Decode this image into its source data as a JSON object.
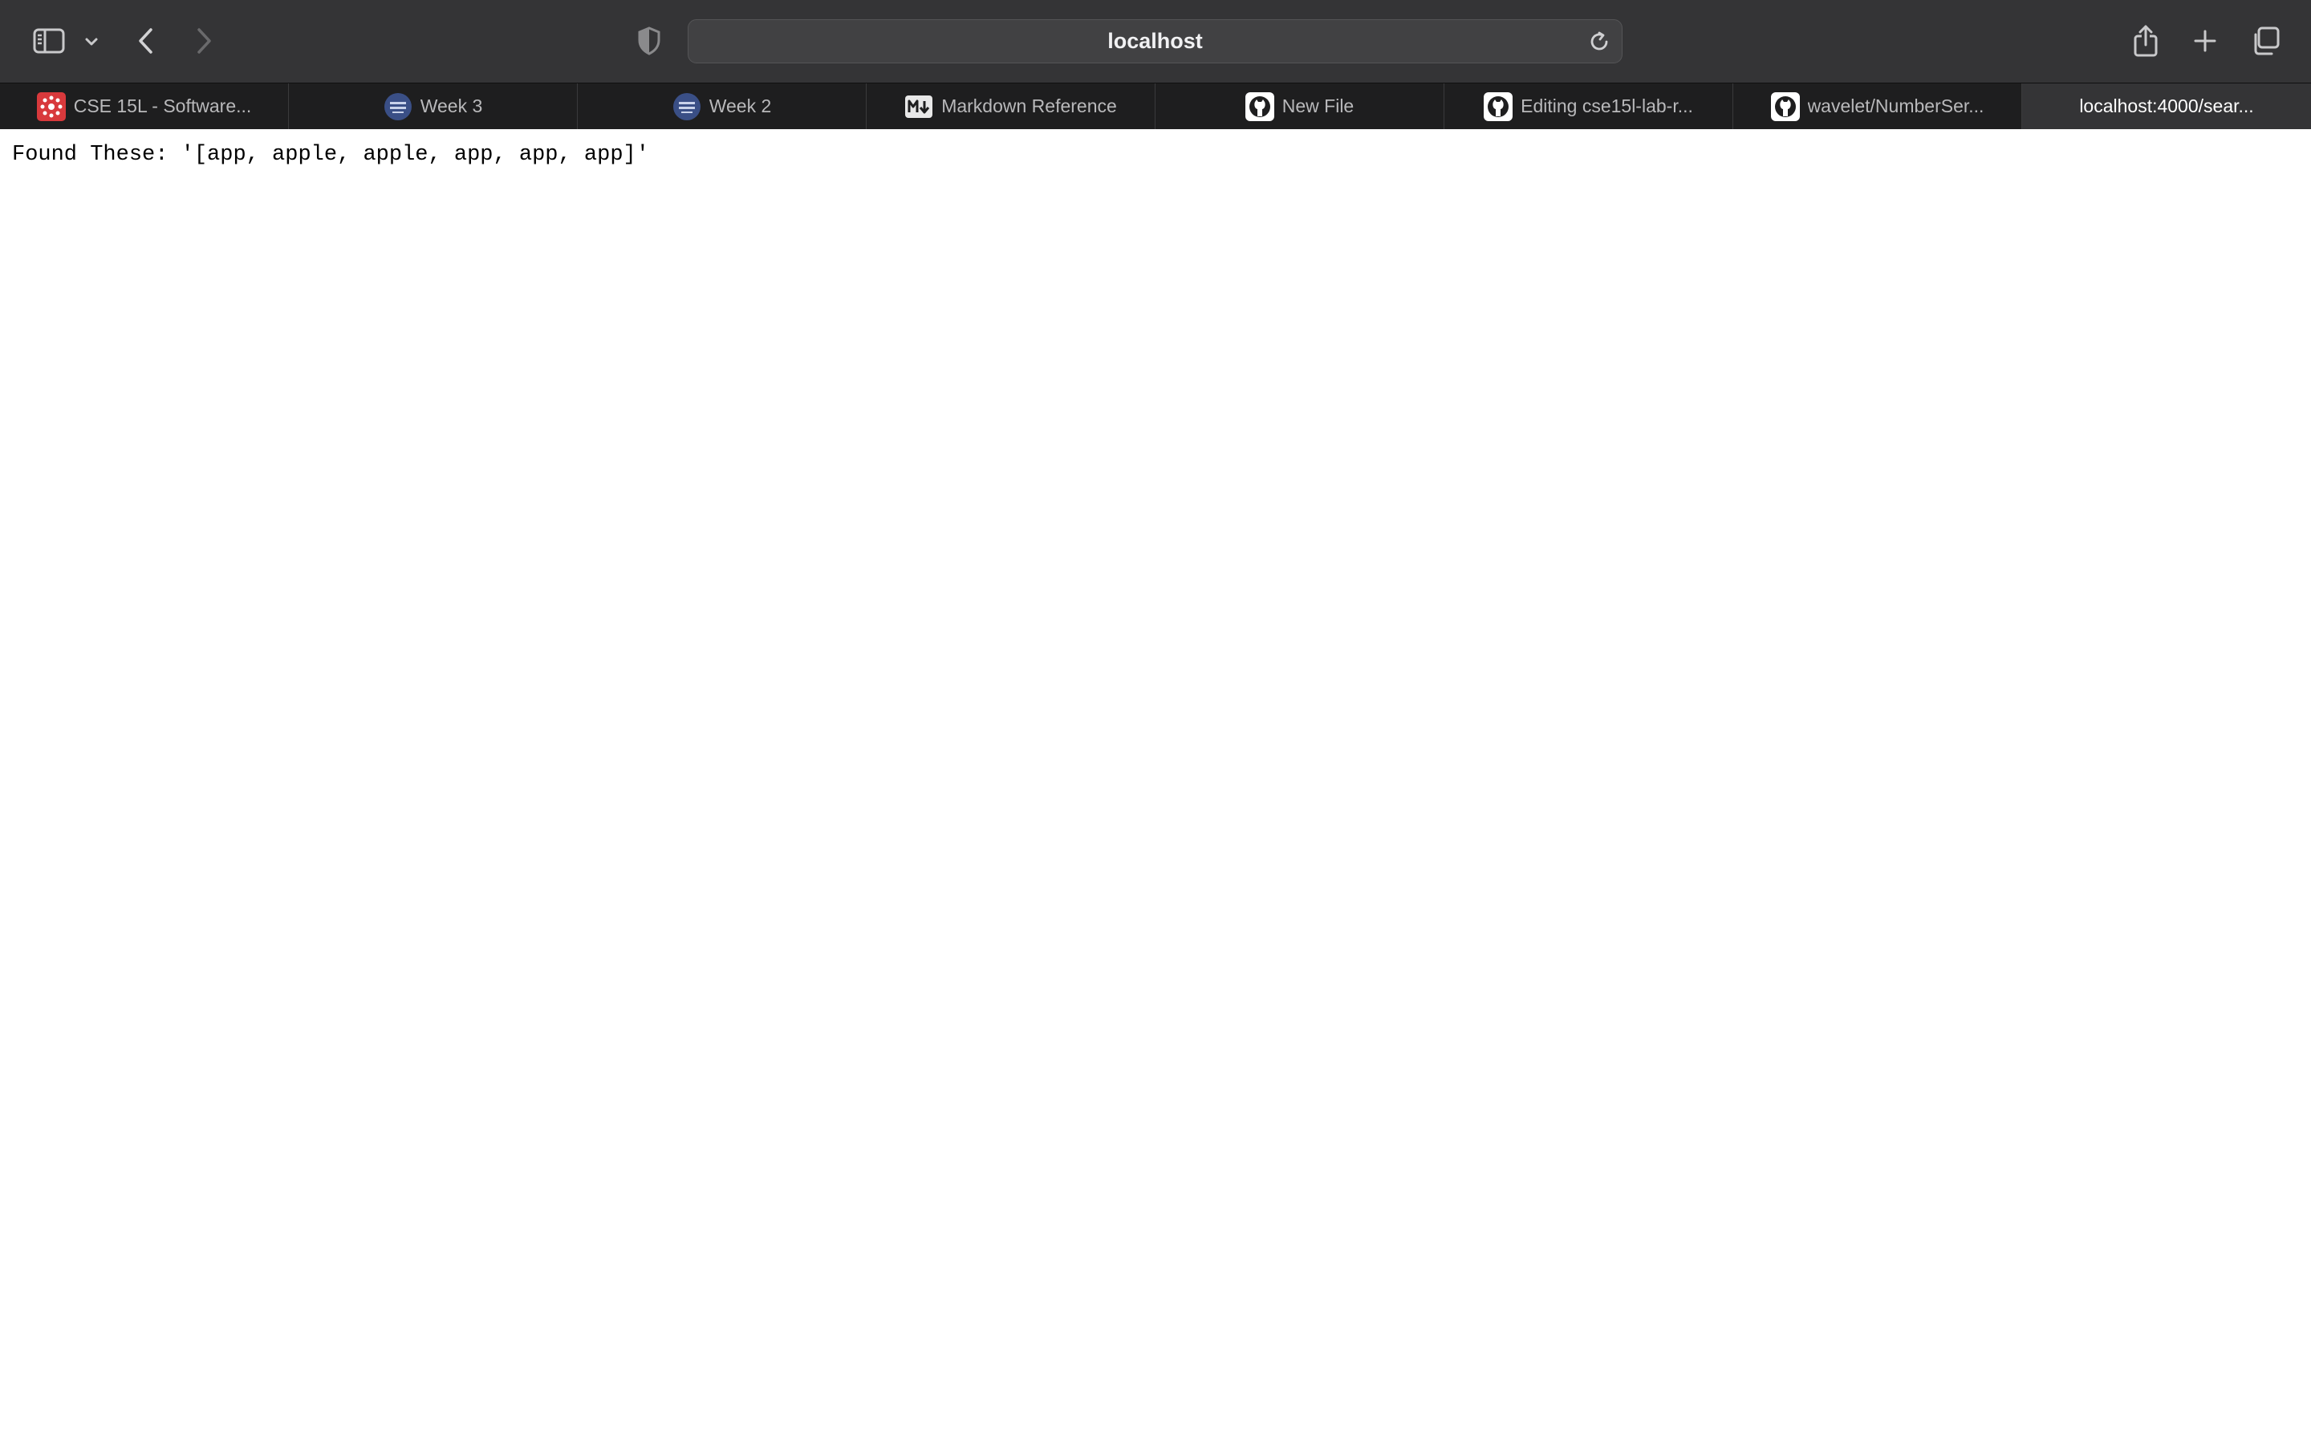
{
  "browser": {
    "address": "localhost",
    "tabs": [
      {
        "label": "CSE 15L - Software...",
        "icon": "canvas-logo-icon"
      },
      {
        "label": "Week 3",
        "icon": "cse-logo-icon"
      },
      {
        "label": "Week 2",
        "icon": "cse-logo-icon"
      },
      {
        "label": "Markdown Reference",
        "icon": "markdown-icon"
      },
      {
        "label": "New File",
        "icon": "github-icon"
      },
      {
        "label": "Editing cse15l-lab-r...",
        "icon": "github-icon"
      },
      {
        "label": "wavelet/NumberSer...",
        "icon": "github-icon"
      },
      {
        "label": "localhost:4000/sear...",
        "active": true
      }
    ]
  },
  "page": {
    "output_text": "Found These: '[app, apple, apple, app, app, app]'"
  },
  "colors": {
    "toolbar": "#343436",
    "tabbar": "#1e1e1f",
    "canvas_red": "#d8393c",
    "cse_blue": "#3a4f86"
  }
}
